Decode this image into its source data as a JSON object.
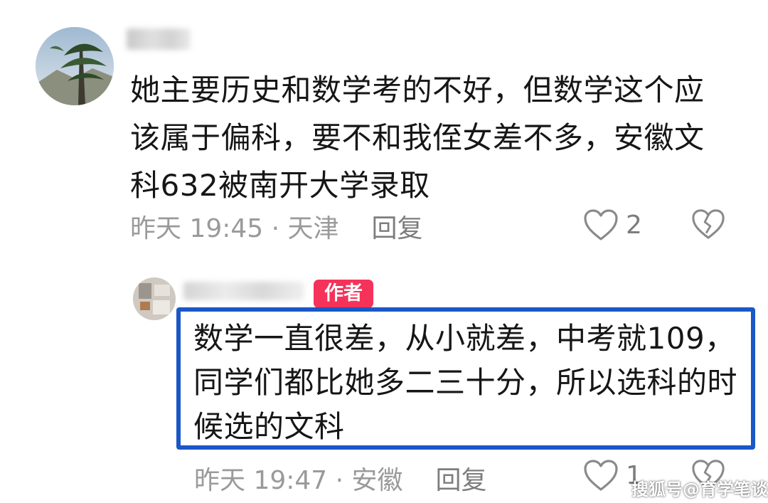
{
  "comments": [
    {
      "text": "她主要历史和数学考的不好，但数学这个应该属于偏科，要不和我侄女差不多，安徽文科632被南开大学录取",
      "meta": "昨天 19:45 · 天津",
      "reply_label": "回复",
      "like_count": "2",
      "icons": [
        "heart-icon",
        "broken-heart-icon"
      ]
    },
    {
      "badge": "作者",
      "text": "数学一直很差，从小就差，中考就109，同学们都比她多二三十分，所以选科的时候选的文科",
      "meta": "昨天 19:47 · 安徽",
      "reply_label": "回复",
      "like_count": "1",
      "icons": [
        "heart-icon",
        "broken-heart-icon"
      ]
    }
  ],
  "watermark": "搜狐号@育学笔谈",
  "colors": {
    "highlight_border": "#1a57c7",
    "author_badge": "#f5325a",
    "meta_text": "#9a9a9a"
  }
}
